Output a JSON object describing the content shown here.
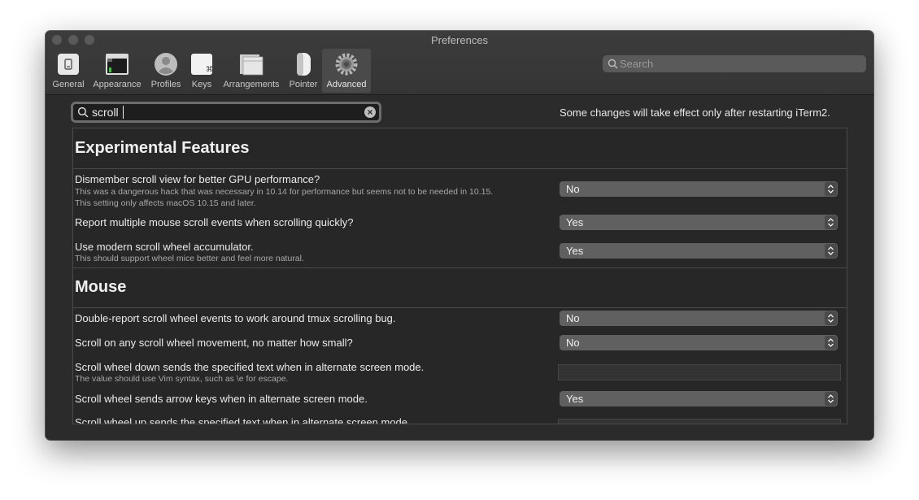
{
  "window": {
    "title": "Preferences"
  },
  "toolbar": {
    "tabs": [
      {
        "label": "General",
        "icon": "general-icon"
      },
      {
        "label": "Appearance",
        "icon": "appearance-icon"
      },
      {
        "label": "Profiles",
        "icon": "profiles-icon"
      },
      {
        "label": "Keys",
        "icon": "keys-icon"
      },
      {
        "label": "Arrangements",
        "icon": "arrangements-icon"
      },
      {
        "label": "Pointer",
        "icon": "pointer-icon"
      },
      {
        "label": "Advanced",
        "icon": "gear-icon",
        "selected": true
      }
    ],
    "search": {
      "placeholder": "Search",
      "value": ""
    }
  },
  "filter": {
    "value": "scroll"
  },
  "notice": "Some changes will take effect only after restarting iTerm2.",
  "sections": [
    {
      "title": "Experimental Features",
      "rows": [
        {
          "title": "Dismember scroll view for better GPU performance?",
          "description": [
            "This was a dangerous hack that was necessary in 10.14 for performance but seems not to be needed in 10.15.",
            "This setting only affects macOS 10.15 and later."
          ],
          "control": "select",
          "value": "No"
        },
        {
          "title": "Report multiple mouse scroll events when scrolling quickly?",
          "control": "select",
          "value": "Yes"
        },
        {
          "title": "Use modern scroll wheel accumulator.",
          "description": [
            "This should support wheel mice better and feel more natural."
          ],
          "control": "select",
          "value": "Yes"
        }
      ]
    },
    {
      "title": "Mouse",
      "rows": [
        {
          "title": "Double-report scroll wheel events to work around tmux scrolling bug.",
          "control": "select",
          "value": "No"
        },
        {
          "title": "Scroll on any scroll wheel movement, no matter how small?",
          "control": "select",
          "value": "No"
        },
        {
          "title": "Scroll wheel down sends the specified text when in alternate screen mode.",
          "description": [
            "The value should use Vim syntax, such as \\e for escape."
          ],
          "control": "text",
          "value": ""
        },
        {
          "title": "Scroll wheel sends arrow keys when in alternate screen mode.",
          "control": "select",
          "value": "Yes"
        },
        {
          "title": "Scroll wheel up sends the specified text when in alternate screen mode.",
          "control": "text",
          "value": ""
        }
      ]
    }
  ],
  "colors": {
    "window_bg": "#2b2b2b",
    "select_bg": "#606060",
    "text": "#ececec"
  }
}
